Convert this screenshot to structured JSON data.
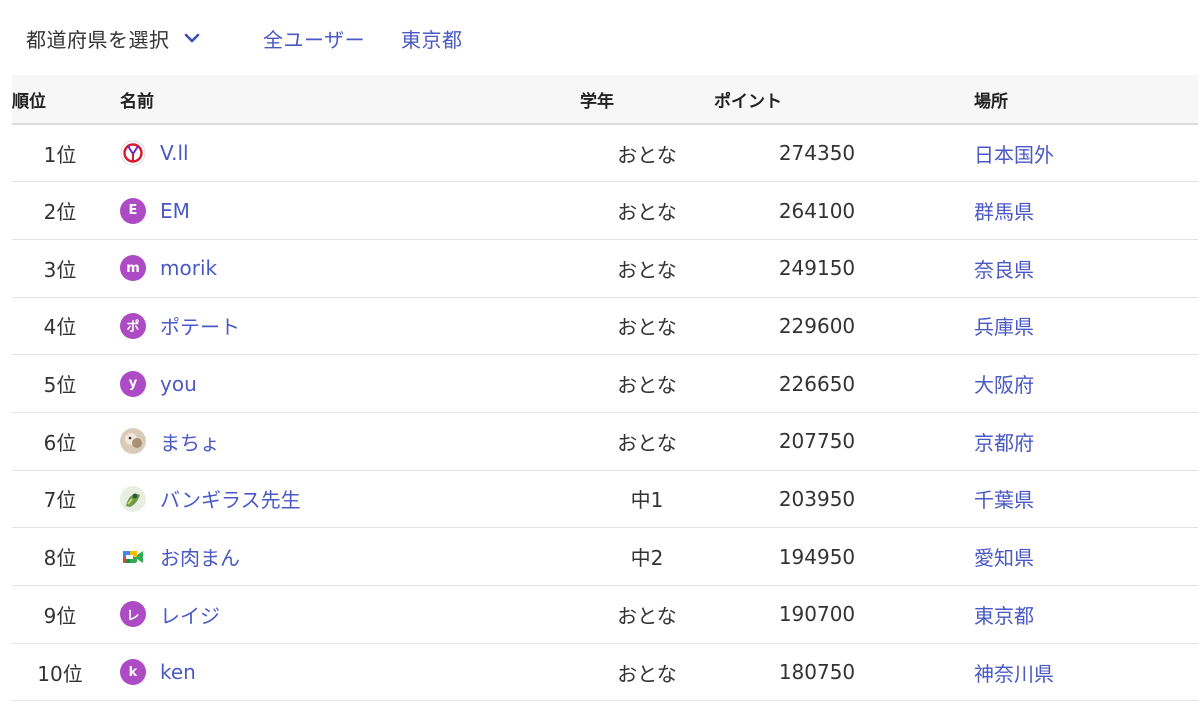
{
  "filter": {
    "prefecture_select_label": "都道府県を選択",
    "all_users_label": "全ユーザー",
    "current_pref_label": "東京都"
  },
  "table": {
    "headers": {
      "rank": "順位",
      "name": "名前",
      "grade": "学年",
      "points": "ポイント",
      "place": "場所"
    },
    "rows": [
      {
        "rank": "1位",
        "avatar_letter": "",
        "avatar_icon": "red-circle-logo-icon",
        "name": "V.ll",
        "grade": "おとな",
        "points": "274350",
        "place": "日本国外"
      },
      {
        "rank": "2位",
        "avatar_letter": "E",
        "name": "EM",
        "grade": "おとな",
        "points": "264100",
        "place": "群馬県"
      },
      {
        "rank": "3位",
        "avatar_letter": "m",
        "name": "morik",
        "grade": "おとな",
        "points": "249150",
        "place": "奈良県"
      },
      {
        "rank": "4位",
        "avatar_letter": "ポ",
        "name": "ポテート",
        "grade": "おとな",
        "points": "229600",
        "place": "兵庫県"
      },
      {
        "rank": "5位",
        "avatar_letter": "y",
        "name": "you",
        "grade": "おとな",
        "points": "226650",
        "place": "大阪府"
      },
      {
        "rank": "6位",
        "avatar_letter": "",
        "avatar_icon": "photo-avatar-icon",
        "name": "まちょ",
        "grade": "おとな",
        "points": "207750",
        "place": "京都府"
      },
      {
        "rank": "7位",
        "avatar_letter": "",
        "avatar_icon": "character-avatar-icon",
        "name": "バンギラス先生",
        "grade": "中1",
        "points": "203950",
        "place": "千葉県"
      },
      {
        "rank": "8位",
        "avatar_letter": "",
        "avatar_icon": "video-camera-logo-icon",
        "name": "お肉まん",
        "grade": "中2",
        "points": "194950",
        "place": "愛知県"
      },
      {
        "rank": "9位",
        "avatar_letter": "レ",
        "name": "レイジ",
        "grade": "おとな",
        "points": "190700",
        "place": "東京都"
      },
      {
        "rank": "10位",
        "avatar_letter": "k",
        "name": "ken",
        "grade": "おとな",
        "points": "180750",
        "place": "神奈川県"
      }
    ]
  },
  "colors": {
    "link": "#4a59c4",
    "avatar_bg": "#ad4bc4",
    "header_bg": "#f7f7f7",
    "row_divider": "#e3e3e3"
  }
}
